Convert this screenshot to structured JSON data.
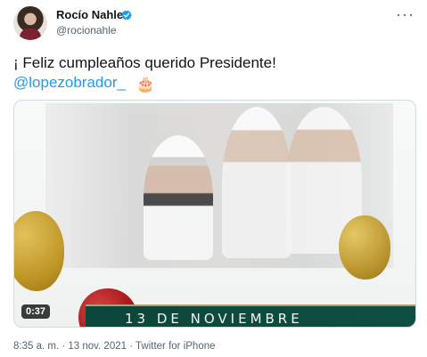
{
  "tweet": {
    "author_name": "Rocío Nahle",
    "author_handle": "@rocionahle",
    "text_line1": "¡ Feliz cumpleaños querido Presidente!",
    "mention": "@lopezobrador_",
    "cake_emoji": "🎂",
    "video": {
      "duration": "0:37",
      "banner_text": "13 DE NOVIEMBRE"
    },
    "timestamp": "8:35 a. m. · 13 nov. 2021 · Twitter for iPhone"
  },
  "colors": {
    "link": "#1d9bf0",
    "secondary_text": "#536471",
    "verified_badge": "#1d9bf0",
    "ribbon": "#0d463a"
  },
  "icons": {
    "verified": "verified-badge-icon",
    "more": "more-options-icon"
  }
}
